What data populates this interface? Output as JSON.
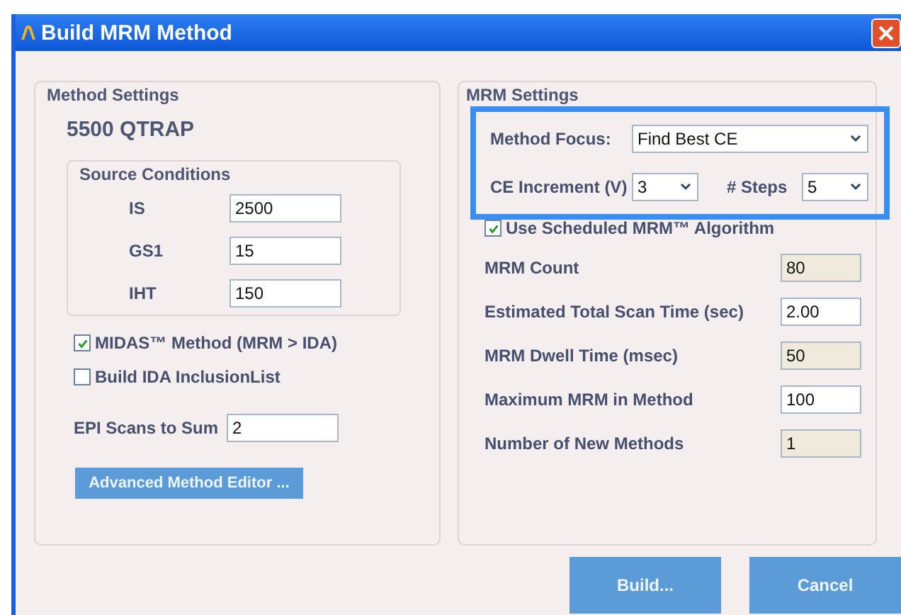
{
  "window": {
    "title": "Build MRM Method"
  },
  "method_settings": {
    "title": "Method Settings",
    "instrument": "5500 QTRAP",
    "source_conditions": {
      "title": "Source Conditions",
      "fields": [
        {
          "label": "IS",
          "value": "2500"
        },
        {
          "label": "GS1",
          "value": "15"
        },
        {
          "label": "IHT",
          "value": "150"
        }
      ]
    },
    "options": [
      {
        "label": "MIDAS™ Method (MRM > IDA)",
        "checked": true
      },
      {
        "label": "Build IDA InclusionList",
        "checked": false
      }
    ],
    "epi_scans": {
      "label": "EPI Scans to Sum",
      "value": "2"
    },
    "advanced_button": "Advanced Method Editor ..."
  },
  "mrm_settings": {
    "title": "MRM Settings",
    "highlighted": true,
    "method_focus": {
      "label": "Method Focus:",
      "value": "Find Best CE"
    },
    "ce_increment": {
      "label": "CE Increment (V)",
      "value": "3"
    },
    "steps": {
      "label": "# Steps",
      "value": "5"
    },
    "scheduled": {
      "label": "Use Scheduled MRM™ Algorithm",
      "checked": true
    },
    "fields": [
      {
        "label": "MRM Count",
        "value": "80",
        "readonly": true
      },
      {
        "label": "Estimated Total Scan Time (sec)",
        "value": "2.00",
        "readonly": false
      },
      {
        "label": "MRM Dwell Time (msec)",
        "value": "50",
        "readonly": true
      },
      {
        "label": "Maximum MRM in Method",
        "value": "100",
        "readonly": false
      },
      {
        "label": "Number of New Methods",
        "value": "1",
        "readonly": true
      }
    ]
  },
  "buttons": [
    "Build...",
    "Cancel"
  ]
}
